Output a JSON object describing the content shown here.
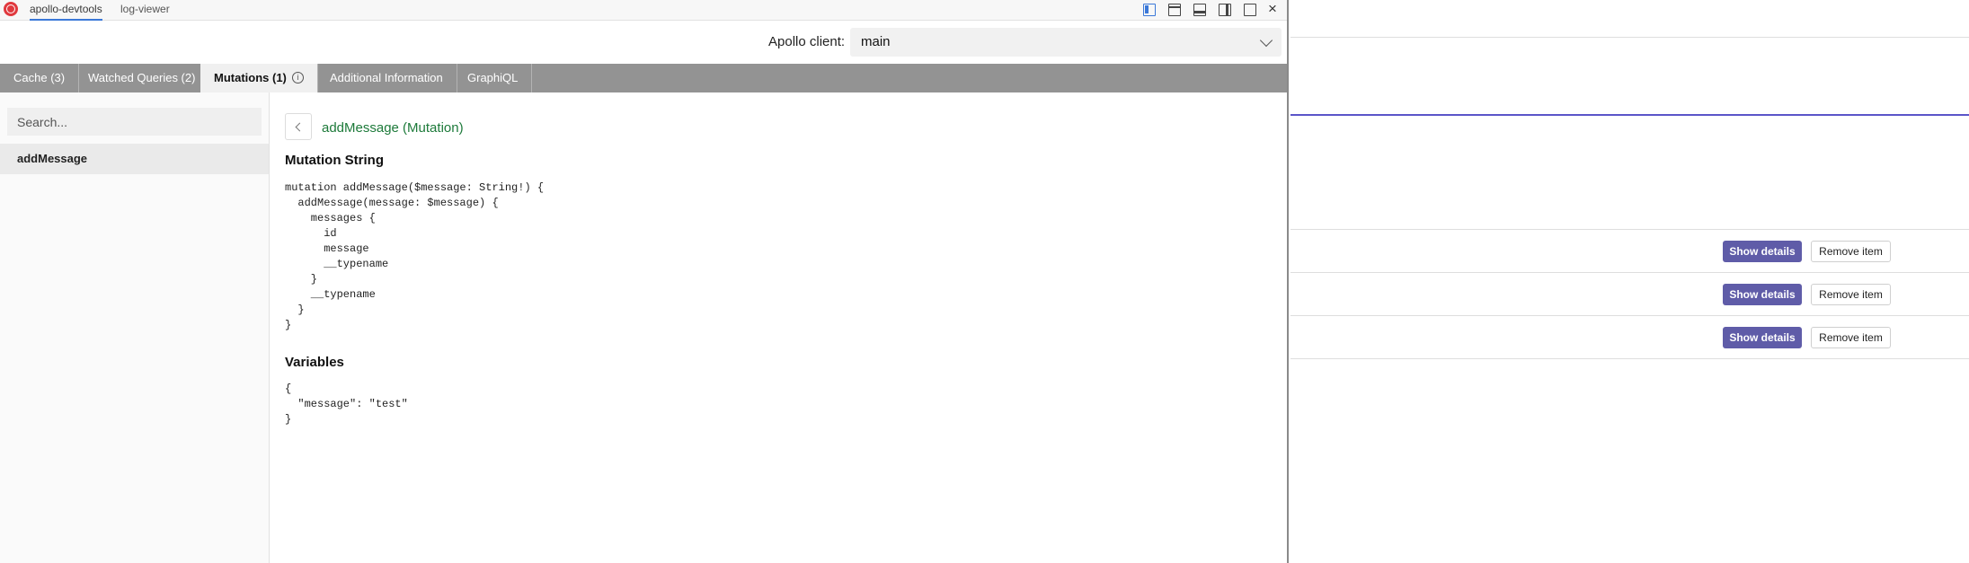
{
  "topbar": {
    "tabs": [
      {
        "label": "apollo-devtools",
        "active": true
      },
      {
        "label": "log-viewer",
        "active": false
      }
    ],
    "window_icons": [
      "dock-left-icon",
      "dock-top-icon",
      "dock-bottom-icon",
      "dock-right-icon",
      "undock-icon"
    ],
    "close_label": "×"
  },
  "client": {
    "label": "Apollo client:",
    "selected": "main"
  },
  "tabs": [
    {
      "label": "Cache (3)"
    },
    {
      "label": "Watched Queries (2)"
    },
    {
      "label": "Mutations (1)",
      "active": true
    },
    {
      "label": "Additional Information"
    },
    {
      "label": "GraphiQL"
    }
  ],
  "info_glyph": "i",
  "sidebar": {
    "search_placeholder": "Search...",
    "items": [
      {
        "label": "addMessage",
        "selected": true
      }
    ]
  },
  "detail": {
    "title": "addMessage (Mutation)",
    "mutation_heading": "Mutation String",
    "mutation_code": "mutation addMessage($message: String!) {\n  addMessage(message: $message) {\n    messages {\n      id\n      message\n      __typename\n    }\n    __typename\n  }\n}",
    "variables_heading": "Variables",
    "variables_code": "{\n  \"message\": \"test\"\n}"
  },
  "page": {
    "rows": [
      {
        "show_label": "Show details",
        "remove_label": "Remove item"
      },
      {
        "show_label": "Show details",
        "remove_label": "Remove item"
      },
      {
        "show_label": "Show details",
        "remove_label": "Remove item"
      }
    ]
  },
  "colors": {
    "accent_blue": "#3b78d8",
    "tab_bar": "#939393",
    "title_green": "#1d7a3a",
    "button_purple": "#5f5ca8",
    "divider_purple": "#5b55c9"
  }
}
